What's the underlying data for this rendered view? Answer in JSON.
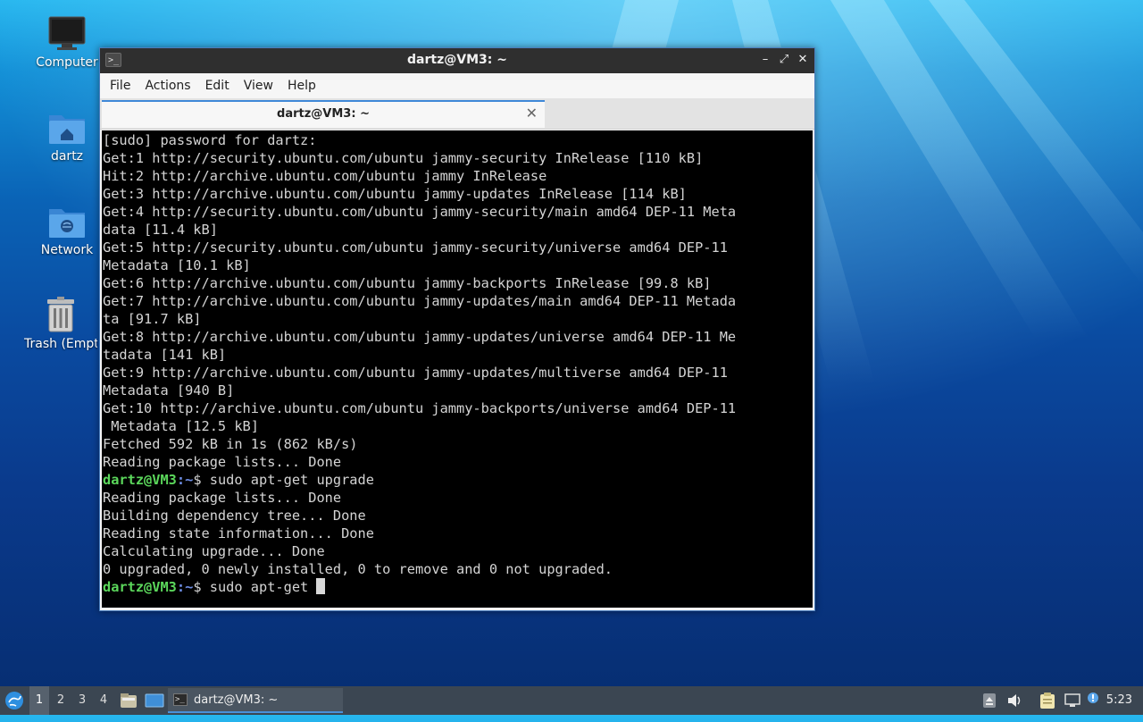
{
  "desktop": {
    "icons": [
      {
        "label": "Computer",
        "icon": "monitor-icon"
      },
      {
        "label": "dartz",
        "icon": "home-folder-icon"
      },
      {
        "label": "Network",
        "icon": "network-folder-icon"
      },
      {
        "label": "Trash (Empty)",
        "icon": "trash-icon"
      }
    ]
  },
  "window": {
    "title": "dartz@VM3: ~",
    "controls": {
      "minimize": "–",
      "maximize": "⤢",
      "close": "✕"
    },
    "menu": [
      "File",
      "Actions",
      "Edit",
      "View",
      "Help"
    ],
    "tab": {
      "label": "dartz@VM3: ~",
      "close": "✕"
    }
  },
  "terminal": {
    "prompt_user": "dartz@VM3",
    "prompt_path": ":~",
    "prompt_symbol": "$ ",
    "lines": [
      "[sudo] password for dartz:",
      "Get:1 http://security.ubuntu.com/ubuntu jammy-security InRelease [110 kB]",
      "Hit:2 http://archive.ubuntu.com/ubuntu jammy InRelease",
      "Get:3 http://archive.ubuntu.com/ubuntu jammy-updates InRelease [114 kB]",
      "Get:4 http://security.ubuntu.com/ubuntu jammy-security/main amd64 DEP-11 Meta",
      "data [11.4 kB]",
      "Get:5 http://security.ubuntu.com/ubuntu jammy-security/universe amd64 DEP-11",
      "Metadata [10.1 kB]",
      "Get:6 http://archive.ubuntu.com/ubuntu jammy-backports InRelease [99.8 kB]",
      "Get:7 http://archive.ubuntu.com/ubuntu jammy-updates/main amd64 DEP-11 Metada",
      "ta [91.7 kB]",
      "Get:8 http://archive.ubuntu.com/ubuntu jammy-updates/universe amd64 DEP-11 Me",
      "tadata [141 kB]",
      "Get:9 http://archive.ubuntu.com/ubuntu jammy-updates/multiverse amd64 DEP-11",
      "Metadata [940 B]",
      "Get:10 http://archive.ubuntu.com/ubuntu jammy-backports/universe amd64 DEP-11",
      " Metadata [12.5 kB]",
      "Fetched 592 kB in 1s (862 kB/s)",
      "Reading package lists... Done"
    ],
    "command_1": "sudo apt-get upgrade",
    "lines_after": [
      "Reading package lists... Done",
      "Building dependency tree... Done",
      "Reading state information... Done",
      "Calculating upgrade... Done",
      "0 upgraded, 0 newly installed, 0 to remove and 0 not upgraded."
    ],
    "command_current": "sudo apt-get "
  },
  "taskbar": {
    "workspaces": [
      "1",
      "2",
      "3",
      "4"
    ],
    "active_workspace": "1",
    "task_label": "dartz@VM3: ~",
    "clock": "5:23",
    "tray_icons": [
      "eject-icon",
      "volume-icon",
      "clipboard-icon",
      "network-icon",
      "updates-icon"
    ]
  }
}
